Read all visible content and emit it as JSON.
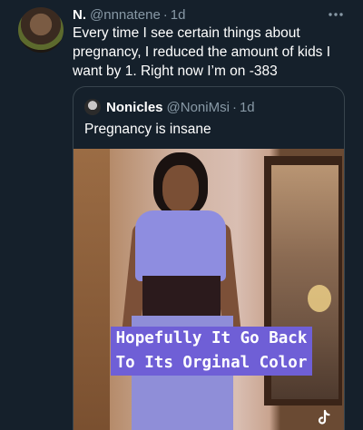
{
  "tweet": {
    "name": "N.",
    "handle": "@nnnatene",
    "separator": "·",
    "time": "1d",
    "text": "Every time I see certain things about pregnancy, I reduced the amount of kids I want by 1. Right now I’m on -383",
    "more_icon": "more-horizontal-icon"
  },
  "quote": {
    "name": "Nonicles",
    "handle": "@NoniMsi",
    "separator": "·",
    "time": "1d",
    "text": "Pregnancy is insane",
    "media": {
      "caption_line1": "Hopefully It Go Back",
      "caption_line2": "To Its Orginal Color",
      "watermark_icon": "tiktok-icon"
    }
  },
  "colors": {
    "background": "#15202b",
    "secondary_text": "#8899a6",
    "border": "#38444d",
    "caption_bg": "#6f5fd6"
  }
}
